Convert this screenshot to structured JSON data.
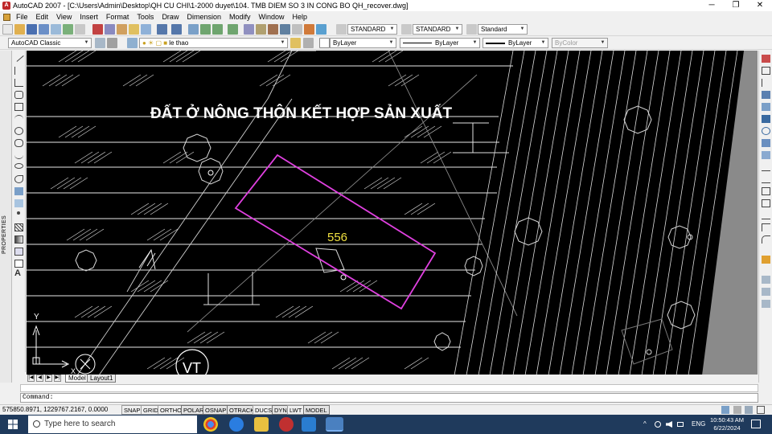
{
  "window": {
    "title": "AutoCAD 2007 - [C:\\Users\\Admin\\Desktop\\QH CU CHI\\1-2000 duyet\\104. TMB DIEM SO 3 IN CONG BO QH_recover.dwg]",
    "app_icon_letter": "A",
    "minimize_glyph": "─",
    "maximize_glyph": "❐",
    "close_glyph": "✕"
  },
  "menu": [
    "File",
    "Edit",
    "View",
    "Insert",
    "Format",
    "Tools",
    "Draw",
    "Dimension",
    "Modify",
    "Window",
    "Help"
  ],
  "toolbar": {
    "text_style": "STANDARD",
    "dim_style": "STANDARD",
    "table_style": "Standard",
    "workspace": "AutoCAD Classic",
    "layer": "le thao",
    "color": "ByLayer",
    "linetype": "ByLayer",
    "lineweight": "ByLayer",
    "plot_style": "ByColor"
  },
  "side": {
    "properties_label": "PROPERTIES",
    "text_tool_glyph": "A"
  },
  "drawing": {
    "heading": "ĐẤT Ở NÔNG THÔN KẾT HỢP SẢN XUẤT",
    "parcel_number": "556",
    "vt_label": "VT",
    "heading_color": "#ffffff",
    "parcel_color": "#e040e0",
    "parcel_label_color": "#f0e040",
    "ucs_x_label": "X",
    "ucs_y_label": "Y"
  },
  "tabs": {
    "nav": [
      "|◀",
      "◀",
      "▶",
      "▶|"
    ],
    "items": [
      "Model",
      "Layout1"
    ],
    "active": "Model"
  },
  "command": {
    "prompt": "Command:"
  },
  "status": {
    "coords": "575850.8971, 1229767.2167, 0.0000",
    "buttons": [
      "SNAP",
      "GRID",
      "ORTHO",
      "POLAR",
      "OSNAP",
      "OTRACK",
      "DUCS",
      "DYN",
      "LWT",
      "MODEL"
    ]
  },
  "taskbar": {
    "search_placeholder": "Type here to search",
    "language": "ENG",
    "time": "10:50:43 AM",
    "date": "6/22/2024",
    "tray_chevron": "^"
  }
}
